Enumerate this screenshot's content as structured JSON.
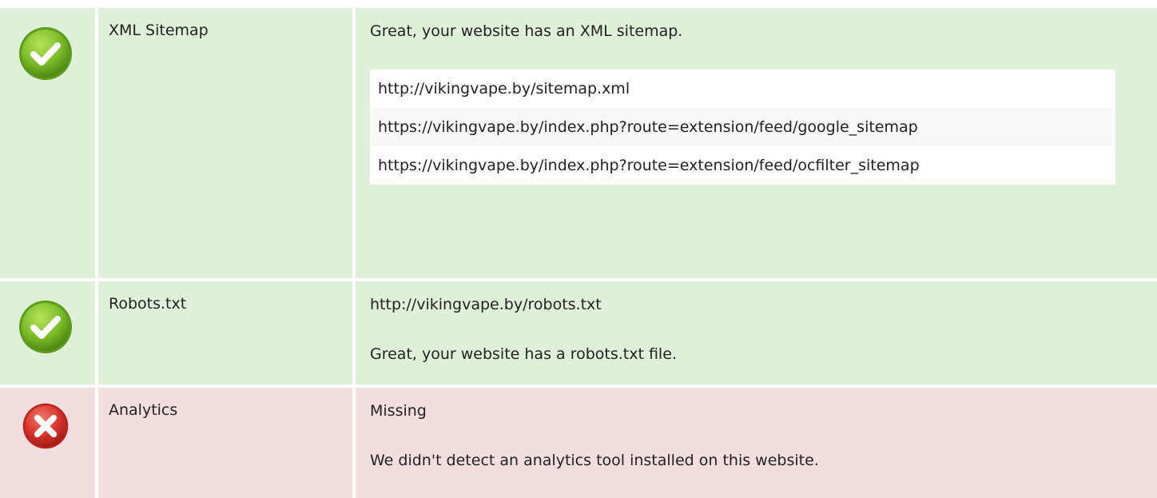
{
  "checks": [
    {
      "status": "pass",
      "icon": "check-icon",
      "label": "XML Sitemap",
      "message": "Great, your website has an XML sitemap.",
      "urls": [
        "http://vikingvape.by/sitemap.xml",
        "https://vikingvape.by/index.php?route=extension/feed/google_sitemap",
        "https://vikingvape.by/index.php?route=extension/feed/ocfilter_sitemap"
      ]
    },
    {
      "status": "pass",
      "icon": "check-icon",
      "label": "Robots.txt",
      "line1": "http://vikingvape.by/robots.txt",
      "line2": "Great, your website has a robots.txt file."
    },
    {
      "status": "fail",
      "icon": "cross-icon",
      "label": "Analytics",
      "line1": "Missing",
      "line2": "We didn't detect an analytics tool installed on this website."
    }
  ],
  "colors": {
    "pass_background": "#dff0d8",
    "fail_background": "#f2dede",
    "pass_icon": "#7cbd2a",
    "fail_icon": "#d9352c"
  }
}
